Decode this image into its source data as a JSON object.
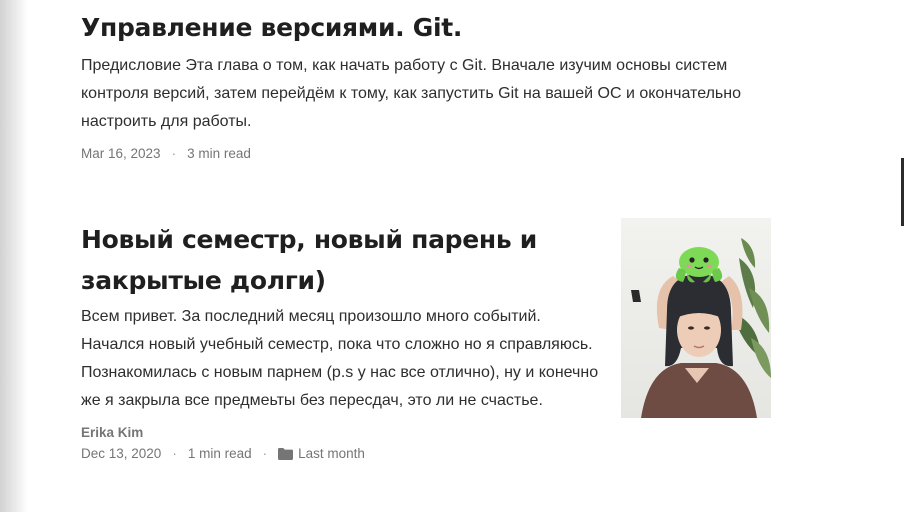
{
  "posts": [
    {
      "title": "Управление версиями. Git.",
      "excerpt": "Предисловие Эта глава о том, как начать работу с Git. Вначале изучим основы систем контроля версий, затем перейдём к тому, как запустить Git на вашей ОС и окончательно настроить для работы.",
      "date": "Mar 16, 2023",
      "read_time": "3 min read"
    },
    {
      "title": "Новый семестр, новый парень и закрытые долги)",
      "excerpt": "Всем привет. За последний месяц произошло много событий. Начался новый учебный семестр, пока что сложно но я справляюсь. Познакомилась с новым парнем (p.s у нас все отлично), ну и конечно же я закрыла все предмеьты без пересдач, это ли не счастье.",
      "author": "Erika Kim",
      "date": "Dec 13, 2020",
      "read_time": "1 min read",
      "category": "Last month"
    }
  ],
  "separator": "·",
  "icons": {
    "category": "folder-icon"
  }
}
